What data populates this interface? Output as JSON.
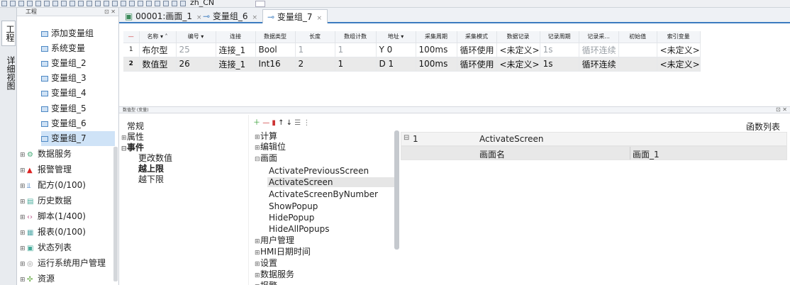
{
  "toolbar": {
    "lang": "zh_CN"
  },
  "vtabs": [
    "工程",
    "详细视图"
  ],
  "project": {
    "title": "工程",
    "var_children": [
      "添加变量组",
      "系统变量",
      "变量组_2",
      "变量组_3",
      "变量组_4",
      "变量组_5",
      "变量组_6",
      "变量组_7"
    ],
    "groups": [
      {
        "label": "数据服务",
        "icon": "gear-icon"
      },
      {
        "label": "报警管理",
        "icon": "alarm-icon"
      },
      {
        "label": "配方(0/100)",
        "icon": "recipe-icon"
      },
      {
        "label": "历史数据",
        "icon": "history-icon"
      },
      {
        "label": "脚本(1/400)",
        "icon": "script-icon"
      },
      {
        "label": "报表(0/100)",
        "icon": "report-icon"
      },
      {
        "label": "状态列表",
        "icon": "status-list-icon"
      },
      {
        "label": "运行系统用户管理",
        "icon": "user-icon"
      },
      {
        "label": "资源",
        "icon": "resource-icon"
      }
    ]
  },
  "tabs": [
    "00001:画面_1",
    "变量组_6",
    "变量组_7"
  ],
  "grid": {
    "headers": [
      "名称",
      "编号",
      "连接",
      "数据类型",
      "长度",
      "数组计数",
      "地址",
      "采集周期",
      "采集模式",
      "数据记录",
      "记录周期",
      "记录采...",
      "初始值",
      "索引变量"
    ],
    "rows": [
      [
        "1",
        "布尔型",
        "25",
        "连接_1",
        "Bool",
        "1",
        "1",
        "Y 0",
        "100ms",
        "循环使用",
        "<未定义>",
        "1s",
        "循环连续",
        "",
        "<未定义>"
      ],
      [
        "2",
        "数值型",
        "26",
        "连接_1",
        "Int16",
        "2",
        "1",
        "D 1",
        "100ms",
        "循环使用",
        "<未定义>",
        "1s",
        "循环连续",
        "",
        "<未定义>"
      ]
    ]
  },
  "panel": {
    "title": "数值型 (变量)"
  },
  "events": {
    "items": [
      "常规",
      "属性",
      "事件",
      "更改数值",
      "越上限",
      "越下限"
    ]
  },
  "functions": {
    "categories": [
      "计算",
      "编辑位",
      "画面"
    ],
    "screen_items": [
      "ActivatePreviousScreen",
      "ActivateScreen",
      "ActivateScreenByNumber",
      "ShowPopup",
      "HidePopup",
      "HideAllPopups"
    ],
    "more": [
      "用户管理",
      "HMI日期时间",
      "设置",
      "数据服务",
      "报警"
    ]
  },
  "fnlist": {
    "title": "函数列表",
    "row1": {
      "index": "1",
      "name": "ActivateScreen"
    },
    "row2": {
      "param": "画面名",
      "value": "画面_1"
    }
  }
}
